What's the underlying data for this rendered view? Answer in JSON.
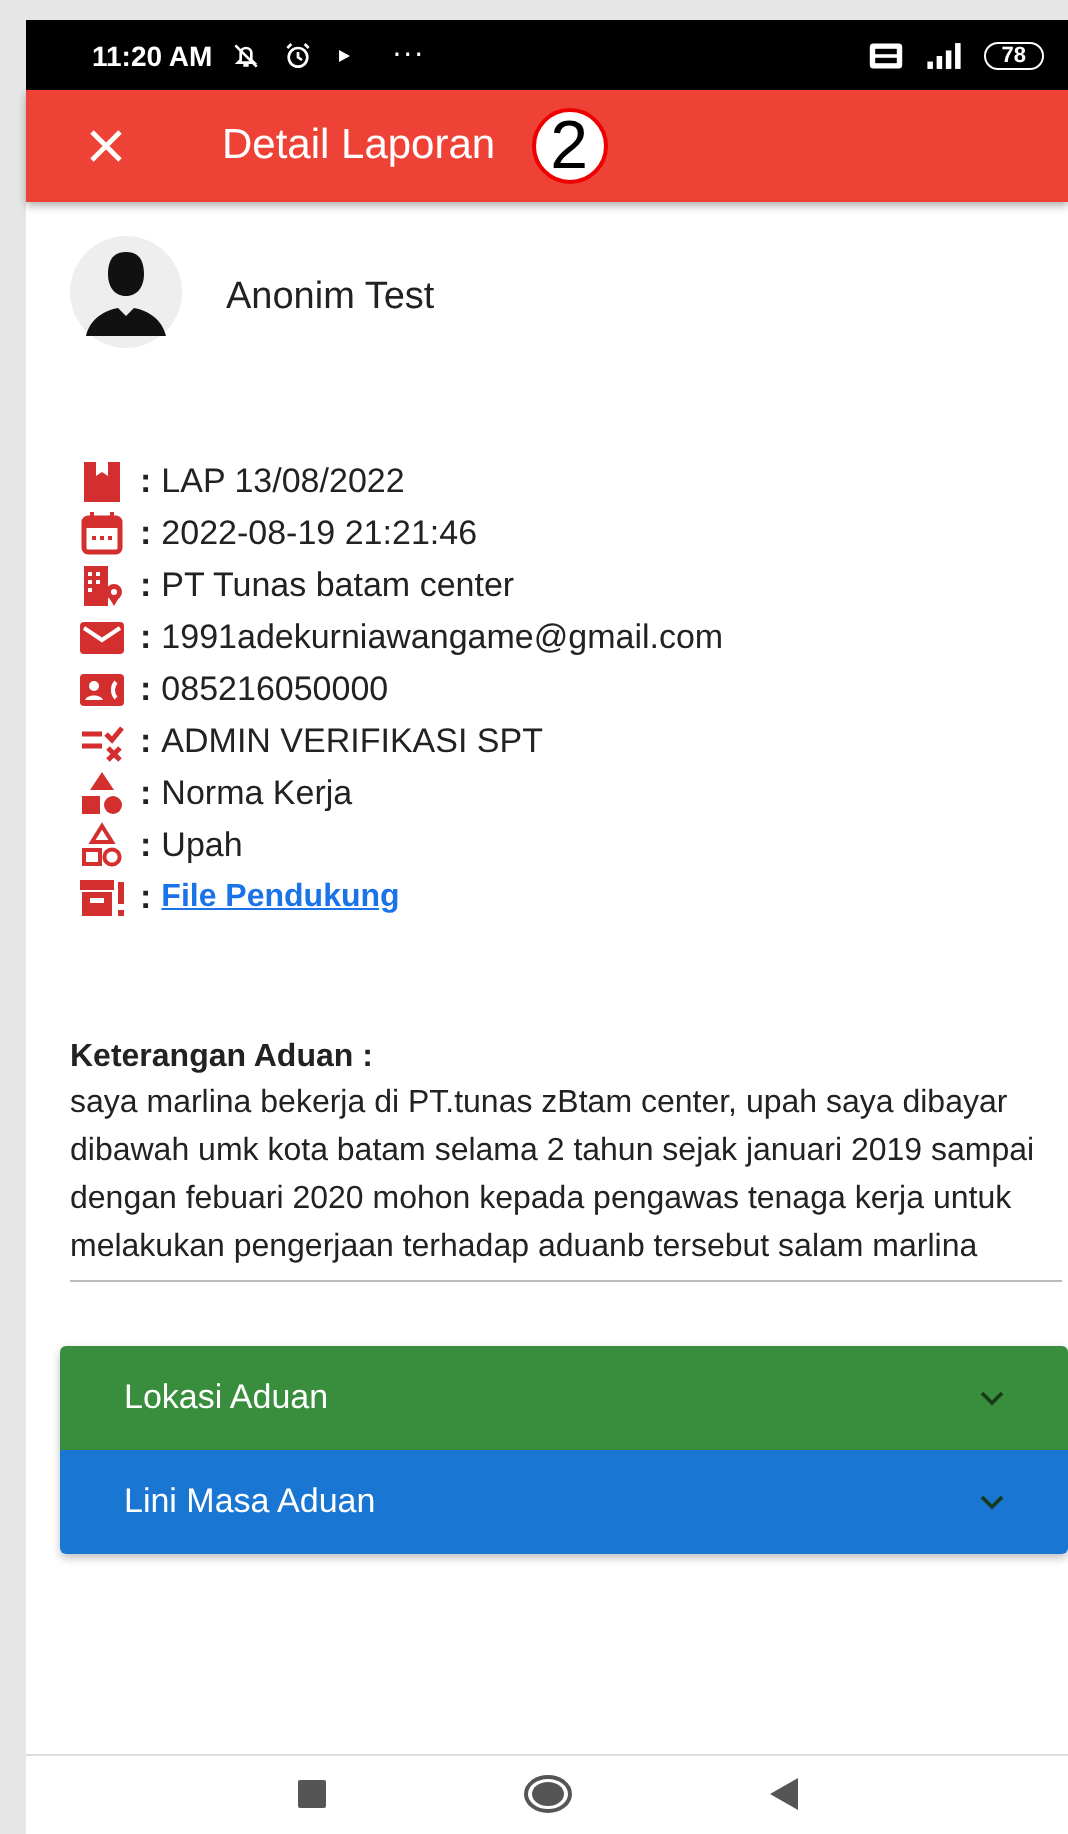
{
  "status_bar": {
    "time": "11:20 AM",
    "dots": "···",
    "battery": "78"
  },
  "app_bar": {
    "title": "Detail Laporan",
    "badge": "2"
  },
  "reporter": {
    "name": "Anonim Test"
  },
  "details": [
    {
      "kind": "report",
      "value": "LAP 13/08/2022"
    },
    {
      "kind": "date",
      "value": "2022-08-19 21:21:46"
    },
    {
      "kind": "company",
      "value": "PT Tunas batam center"
    },
    {
      "kind": "email",
      "value": "1991adekurniawangame@gmail.com"
    },
    {
      "kind": "phone",
      "value": "085216050000"
    },
    {
      "kind": "handler",
      "value": "ADMIN VERIFIKASI SPT"
    },
    {
      "kind": "category",
      "value": "Norma Kerja"
    },
    {
      "kind": "subcategory",
      "value": "Upah"
    },
    {
      "kind": "attachment",
      "value": "File Pendukung"
    }
  ],
  "separator": ":",
  "description": {
    "heading": "Keterangan Aduan :",
    "text": "saya marlina bekerja di PT.tunas zBtam center, upah saya dibayar dibawah umk kota batam selama 2 tahun sejak januari 2019 sampai dengan febuari 2020 mohon kepada pengawas tenaga kerja untuk melakukan pengerjaan terhadap aduanb tersebut salam marlina"
  },
  "panels": [
    {
      "title": "Lokasi Aduan",
      "color": "#388e3c",
      "expanded": false
    },
    {
      "title": "Lini Masa Aduan",
      "color": "#1976d2",
      "expanded": false
    }
  ]
}
